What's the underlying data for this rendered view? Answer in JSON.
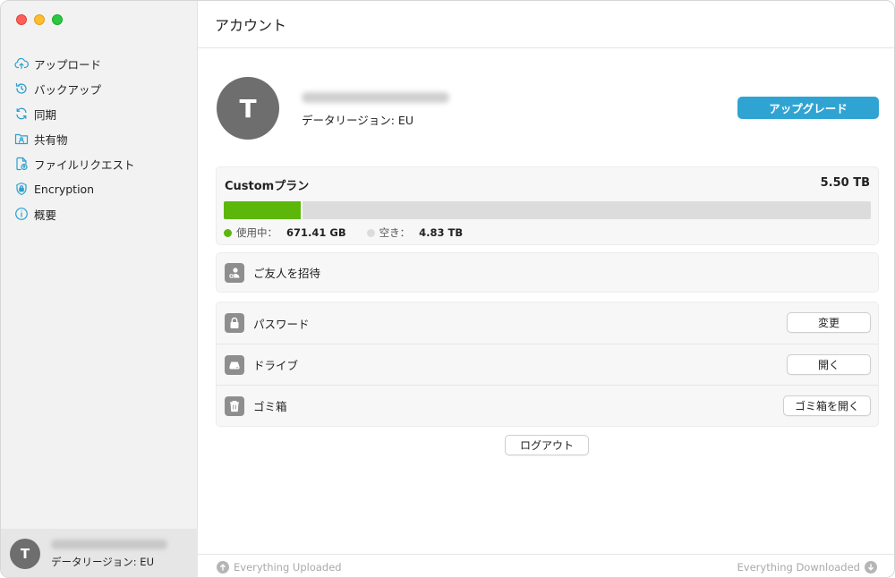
{
  "window": {
    "title": "アカウント"
  },
  "sidebar": {
    "items": [
      {
        "label": "アップロード",
        "icon": "cloud-upload-icon"
      },
      {
        "label": "バックアップ",
        "icon": "backup-icon"
      },
      {
        "label": "同期",
        "icon": "sync-icon"
      },
      {
        "label": "共有物",
        "icon": "shared-folder-icon"
      },
      {
        "label": "ファイルリクエスト",
        "icon": "file-request-icon"
      },
      {
        "label": "Encryption",
        "icon": "encryption-shield-icon"
      },
      {
        "label": "概要",
        "icon": "info-icon"
      }
    ],
    "user": {
      "initial": "T",
      "region": "データリージョン: EU"
    }
  },
  "profile": {
    "initial": "T",
    "region": "データリージョン: EU",
    "upgrade_label": "アップグレード"
  },
  "plan": {
    "name": "Customプラン",
    "total": "5.50 TB",
    "used_fraction": 0.122,
    "used_label": "使用中：",
    "used_value": "671.41 GB",
    "free_label": "空き：",
    "free_value": "4.83 TB",
    "colors": {
      "used": "#5cb70a",
      "free": "#dcdcdc"
    }
  },
  "invite": {
    "label": "ご友人を招待"
  },
  "settings": [
    {
      "label": "パスワード",
      "button": "変更",
      "icon": "lock-icon"
    },
    {
      "label": "ドライブ",
      "button": "開く",
      "icon": "drive-icon"
    },
    {
      "label": "ゴミ箱",
      "button": "ゴミ箱を開く",
      "icon": "trash-icon"
    }
  ],
  "logout_label": "ログアウト",
  "status": {
    "uploaded": "Everything Uploaded",
    "downloaded": "Everything Downloaded"
  },
  "accent": "#2fa4d3"
}
